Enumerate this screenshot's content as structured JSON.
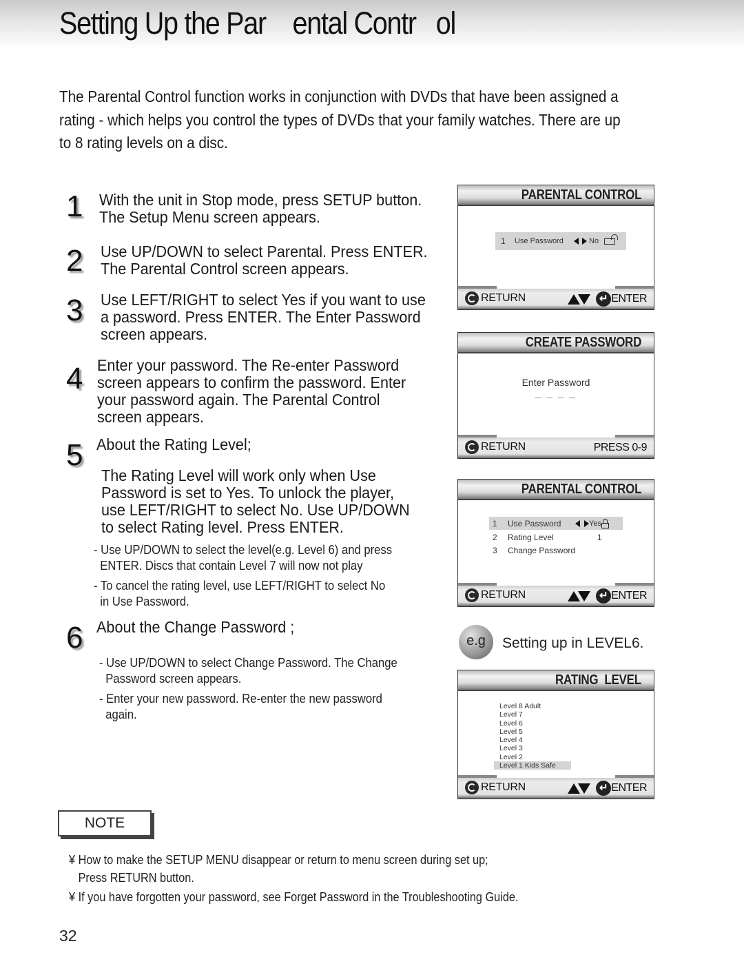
{
  "page": {
    "title": "Setting Up the Par    ental Contr   ol",
    "intro_lines": [
      "The Parental Control function works in conjunction with DVDs that have been assigned a",
      "rating - which helps you control the types of DVDs that your family watches. There are up",
      "to 8 rating levels on a disc."
    ],
    "page_number": "32"
  },
  "steps": [
    {
      "num": "1",
      "lines": [
        "With the unit in Stop mode, press SETUP button.",
        "The Setup Menu screen appears."
      ]
    },
    {
      "num": "2",
      "lines": [
        "Use UP/DOWN to select Parental. Press ENTER.",
        "The Parental Control screen appears."
      ]
    },
    {
      "num": "3",
      "lines": [
        "Use LEFT/RIGHT to select Yes if you want to use",
        "a password. Press ENTER. The Enter Password",
        "screen appears."
      ]
    },
    {
      "num": "4",
      "lines": [
        "Enter your password. The Re-enter Password",
        "screen appears to confirm the password. Enter",
        "your password again. The Parental Control",
        "screen appears."
      ]
    },
    {
      "num": "5",
      "heading": "About the Rating Level;",
      "lines": [
        "The Rating Level will work only when Use",
        "Password is set to Yes. To unlock the player,",
        "use LEFT/RIGHT to select No. Use UP/DOWN",
        "to select Rating level. Press ENTER."
      ],
      "bullets": [
        [
          "- Use UP/DOWN to select the level(e.g. Level 6) and press",
          "  ENTER. Discs that contain Level 7 will now not play"
        ],
        [
          "- To cancel the rating level, use LEFT/RIGHT to select No",
          "  in Use Password."
        ]
      ]
    },
    {
      "num": "6",
      "heading": "About the Change Password ;",
      "bullets": [
        [
          "- Use UP/DOWN to select Change Password. The Change",
          "  Password screen appears."
        ],
        [
          "- Enter your new password. Re-enter the new password",
          "  again."
        ]
      ]
    }
  ],
  "screens": {
    "parental1": {
      "title": "PARENTAL CONTROL",
      "row": {
        "num": "1",
        "label": "Use Password",
        "value": "No",
        "lock": "unlocked"
      },
      "return_label": "RETURN",
      "enter_label": "ENTER"
    },
    "create": {
      "title": "CREATE PASSWORD",
      "prompt": "Enter Password",
      "placeholder": "_ _ _ _",
      "return_label": "RETURN",
      "press_label": "PRESS 0-9"
    },
    "parental2": {
      "title": "PARENTAL CONTROL",
      "rows": [
        {
          "num": "1",
          "label": "Use Password",
          "value": "Yes",
          "lock": "locked",
          "selected": true
        },
        {
          "num": "2",
          "label": "Rating Level",
          "value": "1"
        },
        {
          "num": "3",
          "label": "Change Password",
          "value": ""
        }
      ],
      "return_label": "RETURN",
      "enter_label": "ENTER"
    },
    "rating": {
      "title": "RATING  LEVEL",
      "levels": [
        "Level 8 Adult",
        "Level 7",
        "Level 6",
        "Level 5",
        "Level 4",
        "Level 3",
        "Level 2",
        "Level 1 Kids Safe"
      ],
      "selected": "Level 1 Kids Safe",
      "return_label": "RETURN",
      "enter_label": "ENTER"
    }
  },
  "example": {
    "badge": "e.g",
    "text": "Setting up in LEVEL6."
  },
  "note": {
    "label": "NOTE",
    "bullet_glyph": "¥",
    "lines": [
      "¥ How to make the SETUP MENU disappear or return to menu screen during set up;",
      "   Press RETURN button.",
      "¥ If you have forgotten your password, see Forget Password in the Troubleshooting Guide."
    ]
  }
}
